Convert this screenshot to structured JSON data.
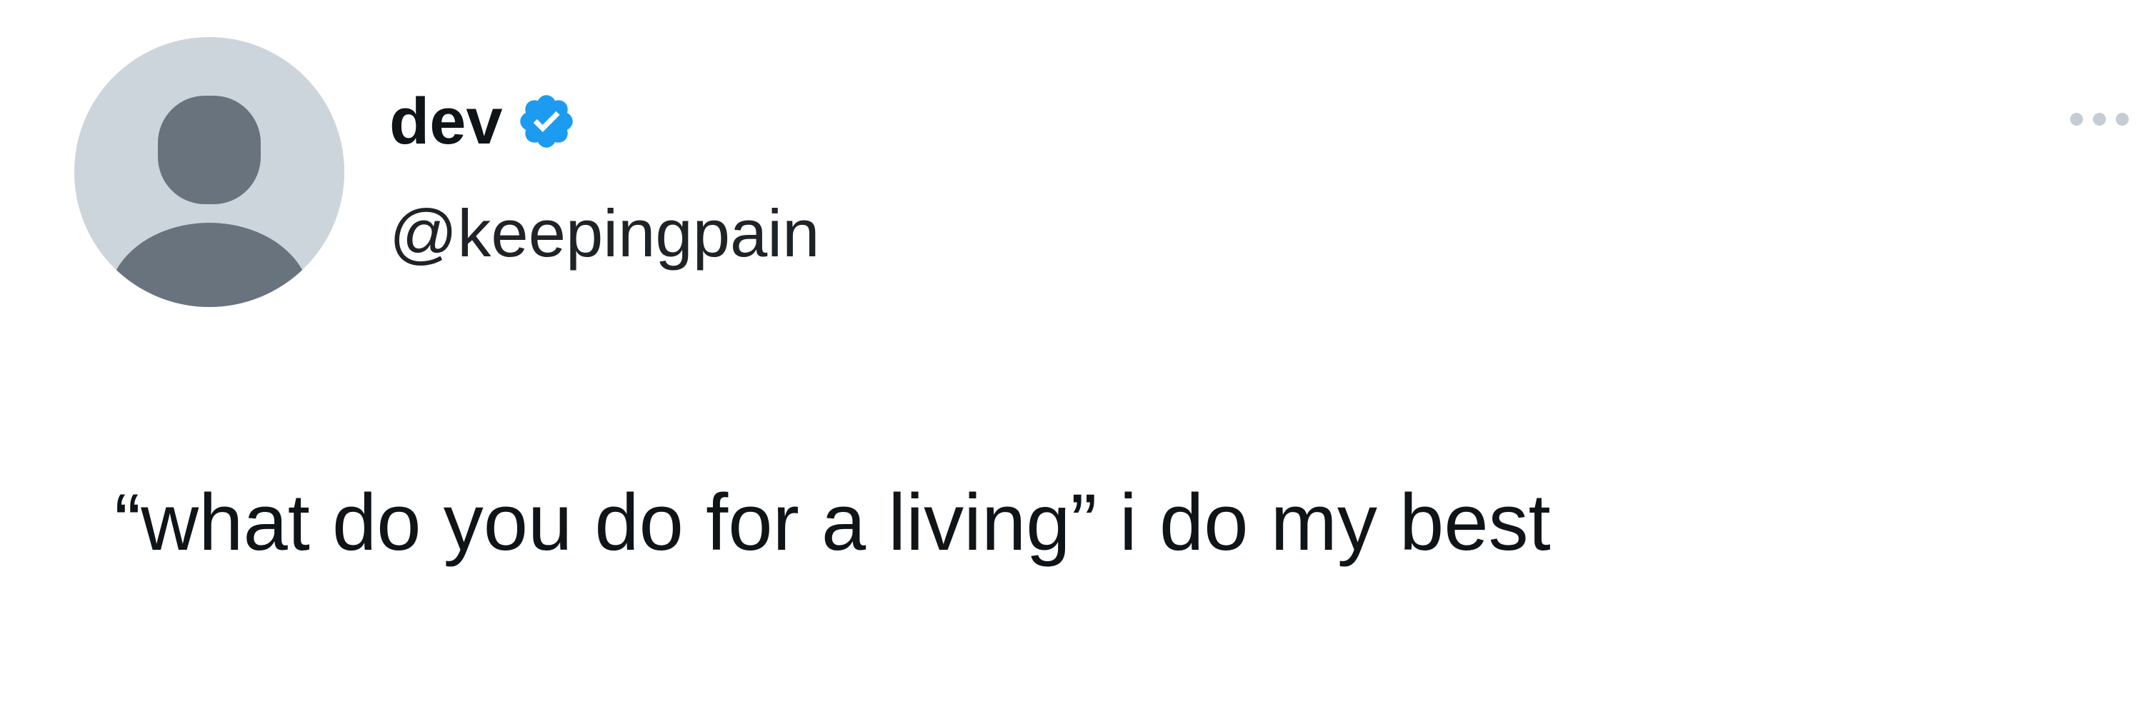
{
  "tweet": {
    "author": {
      "display_name": "dev",
      "handle": "@keepingpain",
      "verified": true,
      "avatar": "default-profile-avatar"
    },
    "text": "“what do you do for a living” i do my best",
    "menu_icon": "more-options-icon"
  },
  "colors": {
    "background": "#ffffff",
    "text": "#0f1419",
    "verified_badge": "#1d9bf0",
    "avatar_bg": "#cdd5dc",
    "avatar_figure": "#68737d",
    "more_dots": "#c5ccd3"
  }
}
